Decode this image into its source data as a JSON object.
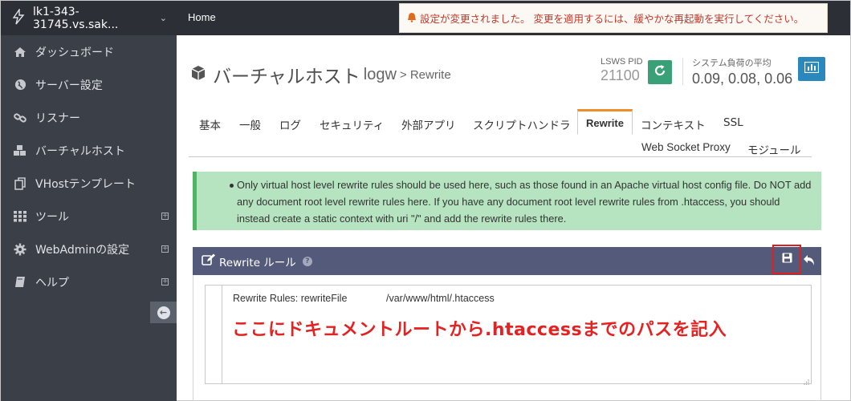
{
  "sidebar": {
    "host": "lk1-343-31745.vs.sak...",
    "items": [
      {
        "label": "ダッシュボード",
        "icon": "home-icon"
      },
      {
        "label": "サーバー設定",
        "icon": "globe-icon"
      },
      {
        "label": "リスナー",
        "icon": "link-icon"
      },
      {
        "label": "バーチャルホスト",
        "icon": "cubes-icon"
      },
      {
        "label": "VHostテンプレート",
        "icon": "copy-icon"
      },
      {
        "label": "ツール",
        "icon": "grid-icon"
      },
      {
        "label": "WebAdminの設定",
        "icon": "gear-icon"
      },
      {
        "label": "ヘルプ",
        "icon": "book-icon"
      }
    ]
  },
  "topbar": {
    "home": "Home",
    "notice": "設定が変更されました。 変更を適用するには、緩やかな再起動を実行してください。"
  },
  "header": {
    "title": "バーチャルホスト",
    "vhost": "logw",
    "crumb": "> Rewrite",
    "pid_label": "LSWS PID",
    "pid_value": "21100",
    "load_label": "システム負荷の平均",
    "load_value": "0.09, 0.08, 0.06"
  },
  "tabs": [
    "基本",
    "一般",
    "ログ",
    "セキュリティ",
    "外部アプリ",
    "スクリプトハンドラ",
    "Rewrite",
    "コンテキスト",
    "SSL",
    "Web Socket Proxy",
    "モジュール"
  ],
  "active_tab": "Rewrite",
  "info": "Only virtual host level rewrite rules should be used here, such as those found in an Apache virtual host config file. Do NOT add any document root level rewrite rules here. If you have any document root level rewrite rules from .htaccess, you should instead create a static context with uri \"/\" and add the rewrite rules there.",
  "panel": {
    "title": "Rewrite ルール",
    "rules_label": "Rewrite Rules: rewriteFile",
    "rules_value": "/var/www/html/.htaccess",
    "annotation": "ここにドキュメントルートから.htaccessまでのパスを記入"
  },
  "colors": {
    "sidebar_bg": "#3a3f48",
    "topbar_bg": "#2c3036",
    "accent_tab": "#f08c29",
    "panel_head": "#545b7a",
    "info_bg": "#b6e4c0",
    "restart_btn": "#3aa077",
    "chart_btn": "#2a88bd",
    "annotation_red": "#e52222"
  }
}
